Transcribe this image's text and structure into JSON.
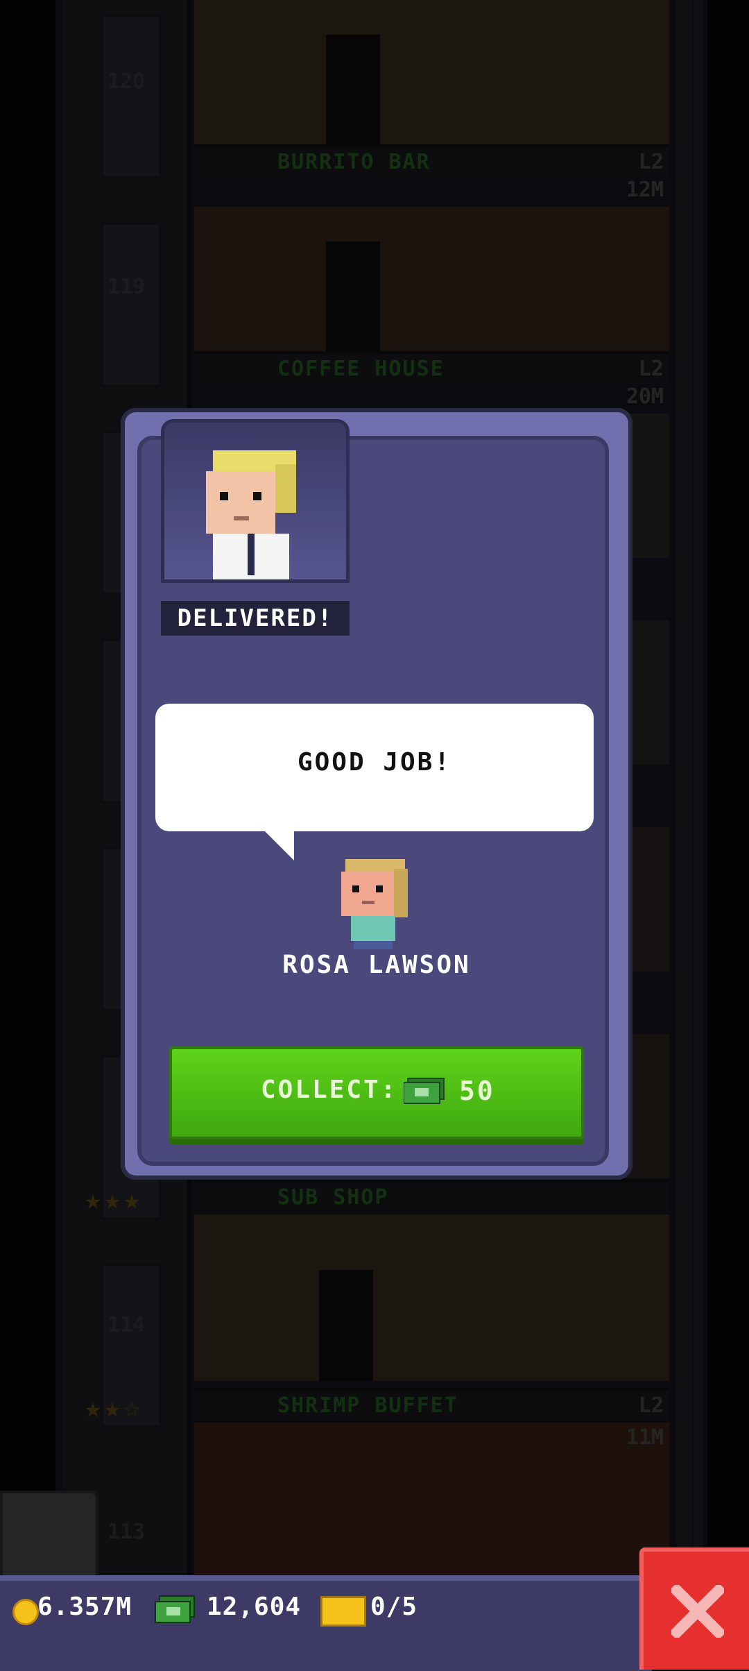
{
  "floors": [
    {
      "number": "120",
      "name": "",
      "level": "",
      "capacity": ""
    },
    {
      "number": "",
      "name": "BURRITO BAR",
      "level": "L2",
      "capacity": "12M"
    },
    {
      "number": "119",
      "name": "",
      "level": "",
      "capacity": ""
    },
    {
      "number": "",
      "name": "COFFEE HOUSE",
      "level": "L2",
      "capacity": "20M"
    },
    {
      "number": "",
      "name": "SUB SHOP",
      "level": "",
      "capacity": ""
    },
    {
      "number": "114",
      "name": "",
      "level": "",
      "capacity": ""
    },
    {
      "number": "",
      "name": "SHRIMP BUFFET",
      "level": "L2",
      "capacity": "11M"
    },
    {
      "number": "113",
      "name": "",
      "level": "",
      "capacity": ""
    }
  ],
  "modal": {
    "status_label": "DELIVERED!",
    "speech": "GOOD JOB!",
    "person_name": "ROSA LAWSON",
    "collect_label": "COLLECT:",
    "collect_amount": "50"
  },
  "bottom_bar": {
    "coins": "6.357M",
    "bux": "12,604",
    "tickets": "0/5"
  },
  "colors": {
    "collect_button": "#4cc316",
    "close_button": "#e6302f",
    "modal": "#4b497c"
  },
  "icons": {
    "coin": "coin-icon",
    "bux": "bux-icon",
    "ticket": "ticket-icon",
    "close": "close-icon"
  }
}
